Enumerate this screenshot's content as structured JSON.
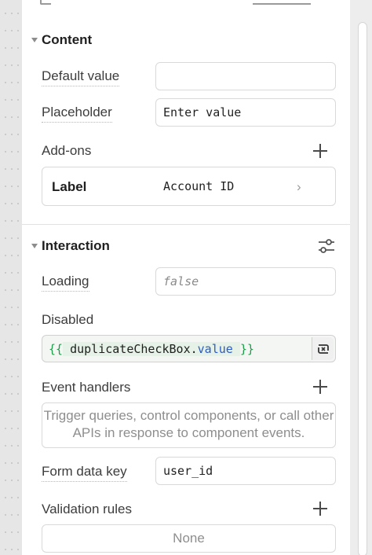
{
  "content_section": {
    "title": "Content",
    "default_value": {
      "label": "Default value",
      "value": ""
    },
    "placeholder": {
      "label": "Placeholder",
      "value": "Enter value"
    },
    "addons": {
      "label": "Add-ons",
      "item": {
        "label": "Label",
        "value": "Account ID",
        "chevron": "›"
      }
    }
  },
  "interaction_section": {
    "title": "Interaction",
    "loading": {
      "label": "Loading",
      "placeholder": "false"
    },
    "disabled": {
      "label": "Disabled",
      "code": {
        "open": "{{",
        "identifier": "duplicateCheckBox",
        "dot": ".",
        "property": "value",
        "close": "}}"
      }
    },
    "event_handlers": {
      "label": "Event handlers",
      "empty_text": "Trigger queries, control components, or call other APIs in response to component events."
    },
    "form_data_key": {
      "label": "Form data key",
      "value": "user_id"
    },
    "validation_rules": {
      "label": "Validation rules",
      "empty_text": "None"
    }
  },
  "icons": {
    "add": "plus-icon",
    "settings": "sliders-icon",
    "expand": "chevron-right-icon",
    "fx": "refresh-code-icon",
    "collapse": "caret-down-icon"
  },
  "colors": {
    "code_brace": "#1e9e4a",
    "code_property": "#2c5cc5",
    "code_background": "#f4f6f4"
  }
}
